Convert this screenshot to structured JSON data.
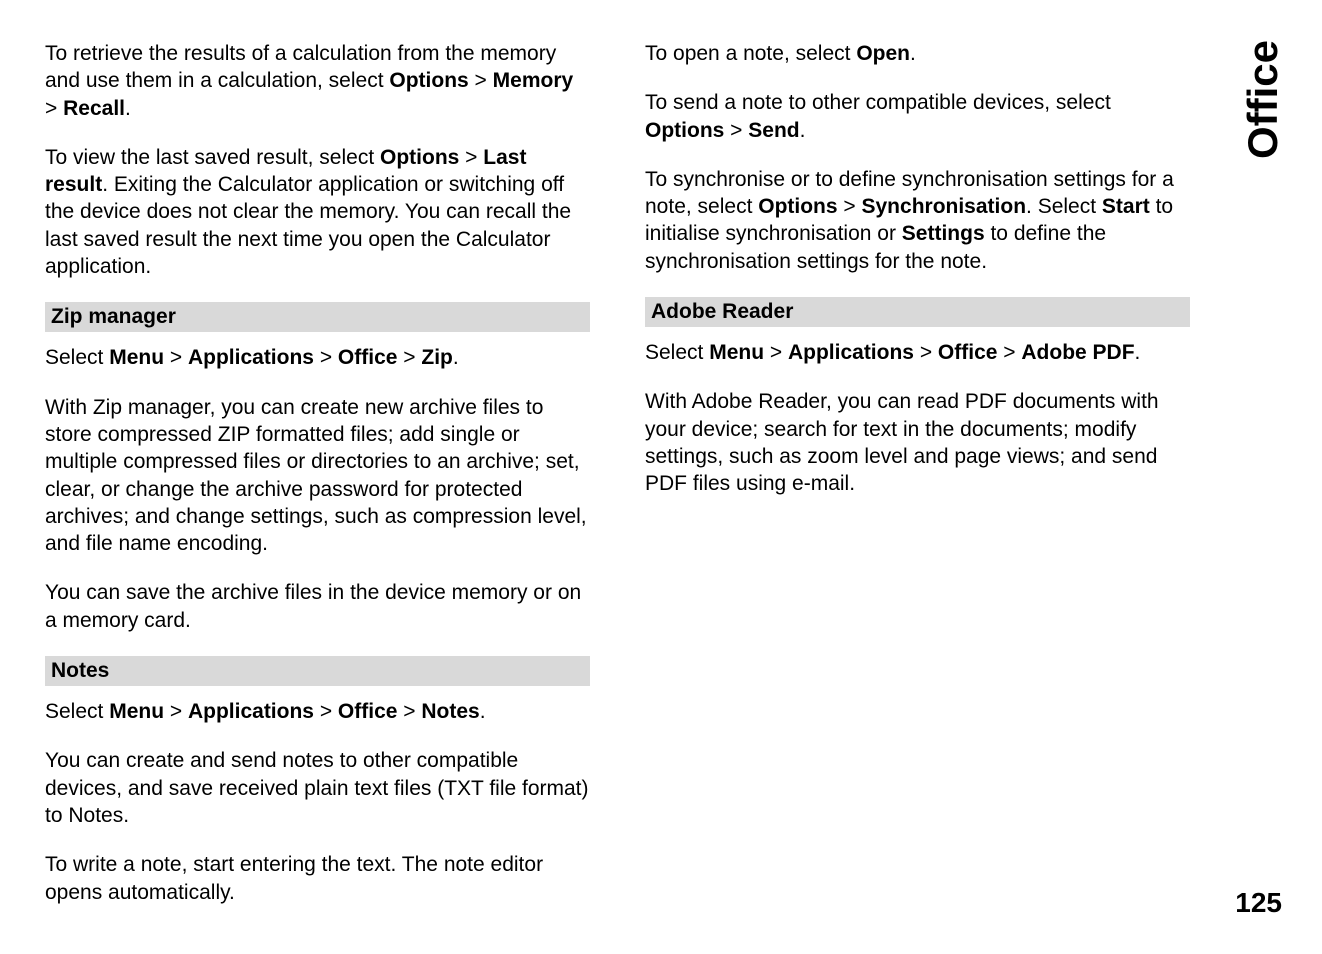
{
  "sideTab": "Office",
  "pageNumber": "125",
  "leftColumn": {
    "para1_part1": "To retrieve the results of a calculation from the memory and use them in a calculation, select ",
    "para1_options": "Options",
    "para1_gt1": " > ",
    "para1_memory": "Memory",
    "para1_gt2": " > ",
    "para1_recall": "Recall",
    "para1_period": ".",
    "para2_part1": "To view the last saved result, select ",
    "para2_options": "Options",
    "para2_gt": " > ",
    "para2_lastresult": "Last result",
    "para2_part2": ". Exiting the Calculator application or switching off the device does not clear the memory. You can recall the last saved result the next time you open the Calculator application.",
    "zipHeader": "Zip manager",
    "zip_para1_part1": "Select ",
    "zip_menu": "Menu",
    "zip_gt1": " > ",
    "zip_apps": "Applications",
    "zip_gt2": " > ",
    "zip_office": "Office",
    "zip_gt3": " > ",
    "zip_zip": "Zip",
    "zip_period": ".",
    "zip_para2": "With Zip manager, you can create new archive files to store compressed ZIP formatted files; add single or multiple compressed files or directories to an archive; set, clear, or change the archive password for protected archives; and change settings, such as compression level, and file name encoding.",
    "zip_para3": "You can save the archive files in the device memory or on a memory card.",
    "notesHeader": "Notes",
    "notes_para1_part1": "Select ",
    "notes_menu": "Menu",
    "notes_gt1": " > ",
    "notes_apps": "Applications",
    "notes_gt2": " > ",
    "notes_office": "Office",
    "notes_gt3": " > ",
    "notes_notes": "Notes",
    "notes_period": ".",
    "notes_para2": "You can create and send notes to other compatible devices, and save received plain text files (TXT file format) to Notes.",
    "notes_para3": "To write a note, start entering the text. The note editor opens automatically."
  },
  "rightColumn": {
    "para1_part1": "To open a note, select ",
    "para1_open": "Open",
    "para1_period": ".",
    "para2_part1": "To send a note to other compatible devices, select ",
    "para2_options": "Options",
    "para2_gt": " > ",
    "para2_send": "Send",
    "para2_period": ".",
    "para3_part1": "To synchronise or to define synchronisation settings for a note, select ",
    "para3_options": "Options",
    "para3_gt": " > ",
    "para3_sync": "Synchronisation",
    "para3_part2": ". Select ",
    "para3_start": "Start",
    "para3_part3": " to initialise synchronisation or ",
    "para3_settings": "Settings",
    "para3_part4": " to define the synchronisation settings for the note.",
    "adobeHeader": "Adobe Reader",
    "adobe_para1_part1": "Select ",
    "adobe_menu": "Menu",
    "adobe_gt1": " > ",
    "adobe_apps": "Applications",
    "adobe_gt2": " > ",
    "adobe_office": "Office",
    "adobe_gt3": " > ",
    "adobe_pdf": "Adobe PDF",
    "adobe_period": ".",
    "adobe_para2": "With Adobe Reader, you can read PDF documents with your device; search for text in the documents; modify settings, such as zoom level and page views; and send PDF files using e-mail."
  }
}
